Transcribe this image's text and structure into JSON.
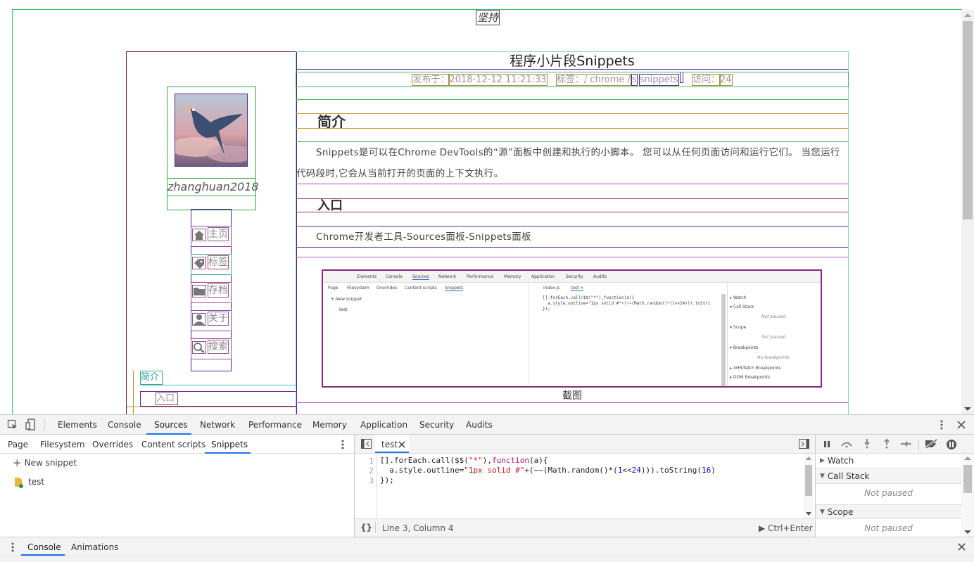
{
  "page": {
    "motto": "坚持",
    "author": {
      "name": "zhanghuan2018"
    },
    "nav": [
      {
        "label": "主页",
        "icon": "home-icon"
      },
      {
        "label": "标签",
        "icon": "tag-icon"
      },
      {
        "label": "存档",
        "icon": "folder-icon"
      },
      {
        "label": "关于",
        "icon": "user-icon"
      },
      {
        "label": "搜索",
        "icon": "search-icon"
      }
    ],
    "toc": {
      "item1": "简介",
      "item2": "入口"
    },
    "article": {
      "title": "程序小片段Snippets",
      "meta": {
        "published_label": "发布于：",
        "published_value": "2018-12-12 11:21:33",
        "tags_label": "标签：/ chrome /",
        "tag_s": "s",
        "tag_snippets": "snippets",
        "visits_label": "访问：",
        "visits_value": "24"
      },
      "sections": [
        {
          "heading": "简介",
          "text": "Snippets是可以在Chrome DevTools的“源”面板中创建和执行的小脚本。 您可以从任何页面访问和运行它们。 当您运行代码段时,它会从当前打开的页面的上下文执行。"
        },
        {
          "heading": "入口",
          "text": "Chrome开发者工具-Sources面板-Snippets面板"
        }
      ],
      "caption": "截图",
      "screenshot": {
        "tabs": [
          "Elements",
          "Console",
          "Sources",
          "Network",
          "Performance",
          "Memory",
          "Application",
          "Security",
          "Audits"
        ],
        "subtabs": [
          "Page",
          "Filesystem",
          "Overrides",
          "Content scripts",
          "Snippets"
        ],
        "files": [
          "index.js",
          "test ×"
        ],
        "new_snippet": "+ New snippet",
        "file": "test",
        "line1": "[].forEach.call($$(\"*\"),function(a){",
        "line2": "  a.style.outline=\"1px solid #\"+(~~(Math.random()*(1<<24))).toStri",
        "line3": "});",
        "panes": [
          "▸ Watch",
          "▾ Call Stack",
          "Not paused",
          "▾ Scope",
          "Not paused",
          "▾ Breakpoints",
          "No breakpoints",
          "▸ XHR/fetch Breakpoints",
          "▸ DOM Breakpoints"
        ]
      }
    }
  },
  "devtools": {
    "tabs": [
      "Elements",
      "Console",
      "Sources",
      "Network",
      "Performance",
      "Memory",
      "Application",
      "Security",
      "Audits"
    ],
    "active_tab": "Sources",
    "nav_tabs": [
      "Page",
      "Filesystem",
      "Overrides",
      "Content scripts",
      "Snippets"
    ],
    "new_snippet": "New snippet",
    "snippet_file": "test",
    "editor_tab": "test",
    "code": {
      "line1_a": "[].forEach.call($$(",
      "line1_s": "\"*\"",
      "line1_b": "),",
      "line1_kw": "function",
      "line1_c": "(a){",
      "line2_a": "  a.style.outline=",
      "line2_s": "\"1px solid #\"",
      "line2_b": "+(~~(Math.random()*(",
      "line2_n1": "1",
      "line2_c": "<<",
      "line2_n2": "24",
      "line2_d": "))).toString(",
      "line2_n3": "16",
      "line2_e": ")",
      "line3": "});"
    },
    "line_numbers": [
      "1",
      "2",
      "3"
    ],
    "status": {
      "braces": "{}",
      "position": "Line 3, Column 4",
      "run": "▶ Ctrl+Enter"
    },
    "debugger": {
      "watch": "Watch",
      "call_stack": "Call Stack",
      "not_paused_1": "Not paused",
      "scope": "Scope",
      "not_paused_2": "Not paused"
    },
    "drawer": {
      "tabs": [
        "Console",
        "Animations"
      ],
      "active": "Console"
    }
  }
}
